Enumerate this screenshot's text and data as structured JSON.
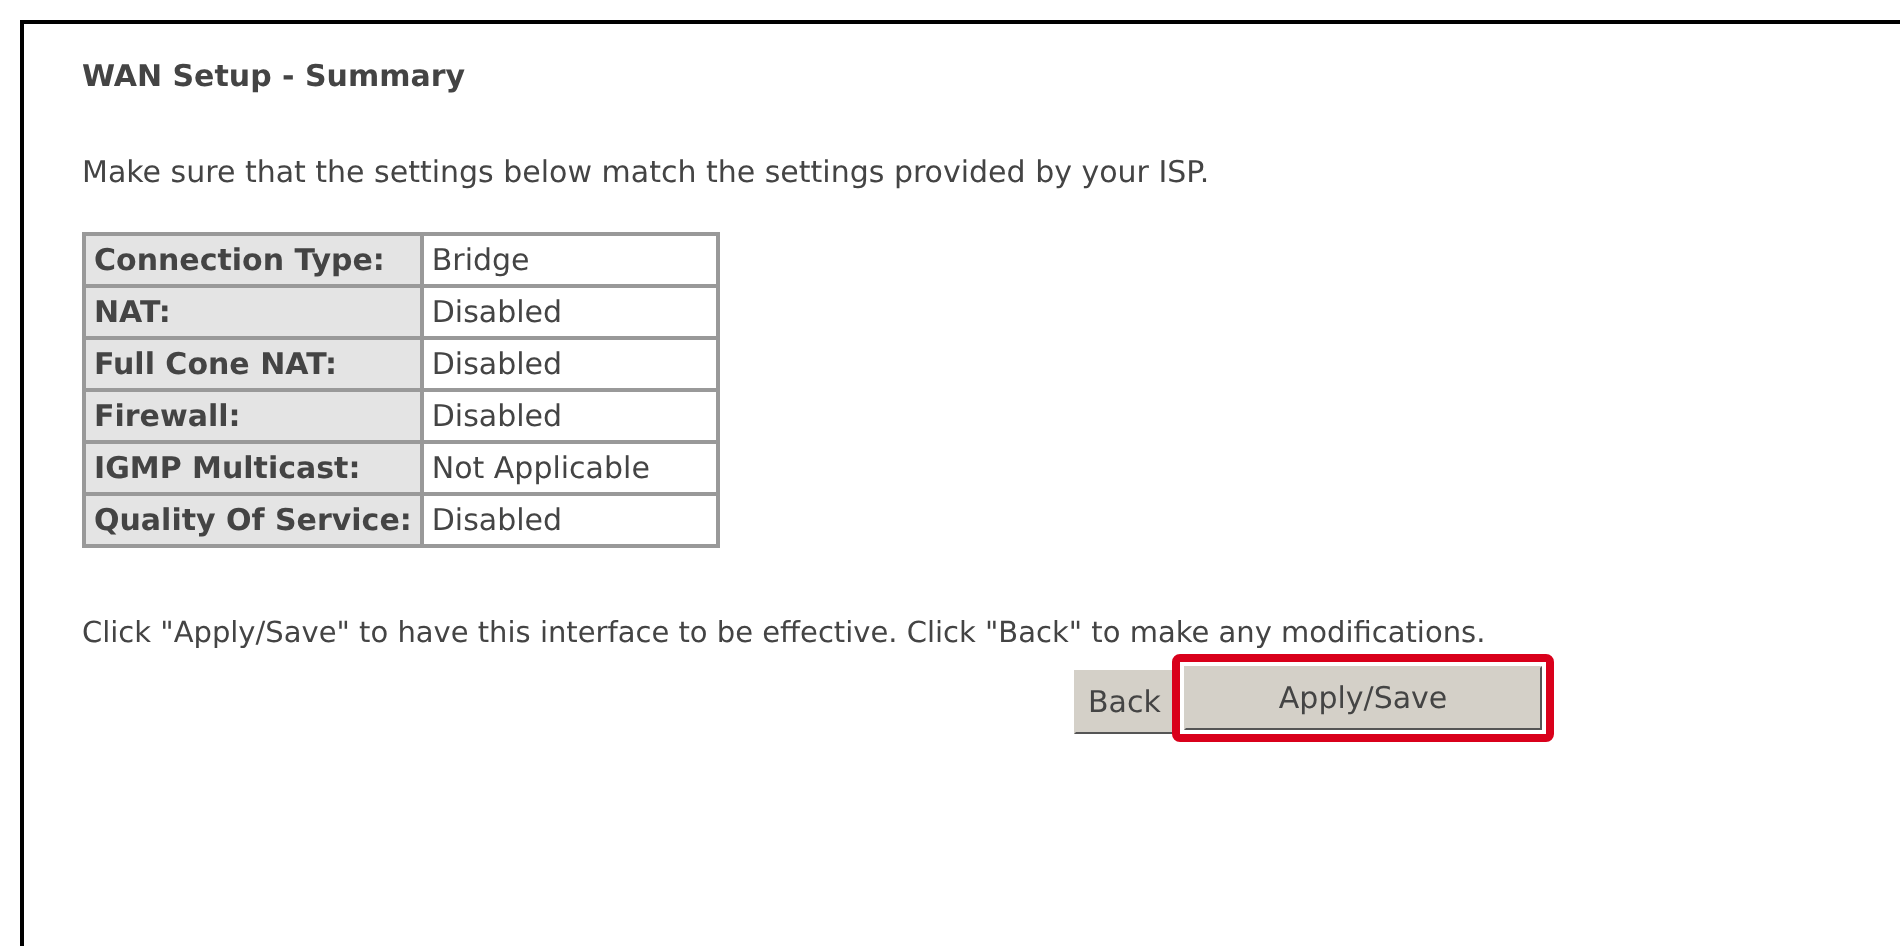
{
  "title": "WAN Setup - Summary",
  "intro": "Make sure that the settings below match the settings provided by your ISP.",
  "summary": [
    {
      "label": "Connection Type:",
      "value": "Bridge"
    },
    {
      "label": "NAT:",
      "value": "Disabled"
    },
    {
      "label": "Full Cone NAT:",
      "value": "Disabled"
    },
    {
      "label": "Firewall:",
      "value": "Disabled"
    },
    {
      "label": "IGMP Multicast:",
      "value": "Not Applicable"
    },
    {
      "label": "Quality Of Service:",
      "value": "Disabled"
    }
  ],
  "note": "Click \"Apply/Save\" to have this interface to be effective. Click \"Back\" to make any modifications.",
  "buttons": [
    {
      "label": "Back",
      "highlighted": false
    },
    {
      "label": "Apply/Save",
      "highlighted": true
    }
  ]
}
